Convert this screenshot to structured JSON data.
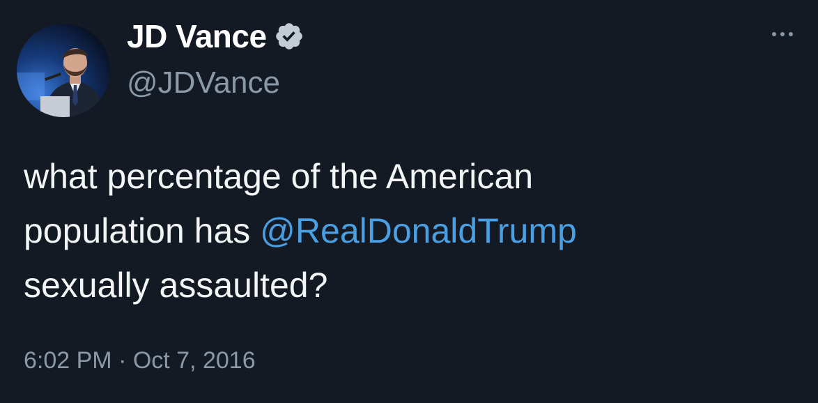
{
  "author": {
    "display_name": "JD Vance",
    "handle": "@JDVance",
    "verified": true
  },
  "tweet": {
    "line1": "what percentage of the American",
    "line2_prefix": "population has ",
    "mention": "@RealDonaldTrump",
    "line3": "sexually assaulted?"
  },
  "meta": {
    "time": "6:02 PM",
    "separator": " · ",
    "date": "Oct 7, 2016"
  },
  "icons": {
    "verified": "verified-badge-icon",
    "more": "more-options-icon"
  },
  "colors": {
    "background": "#141a24",
    "mention": "#4a9fe3",
    "secondary_text": "#8b98a5"
  }
}
